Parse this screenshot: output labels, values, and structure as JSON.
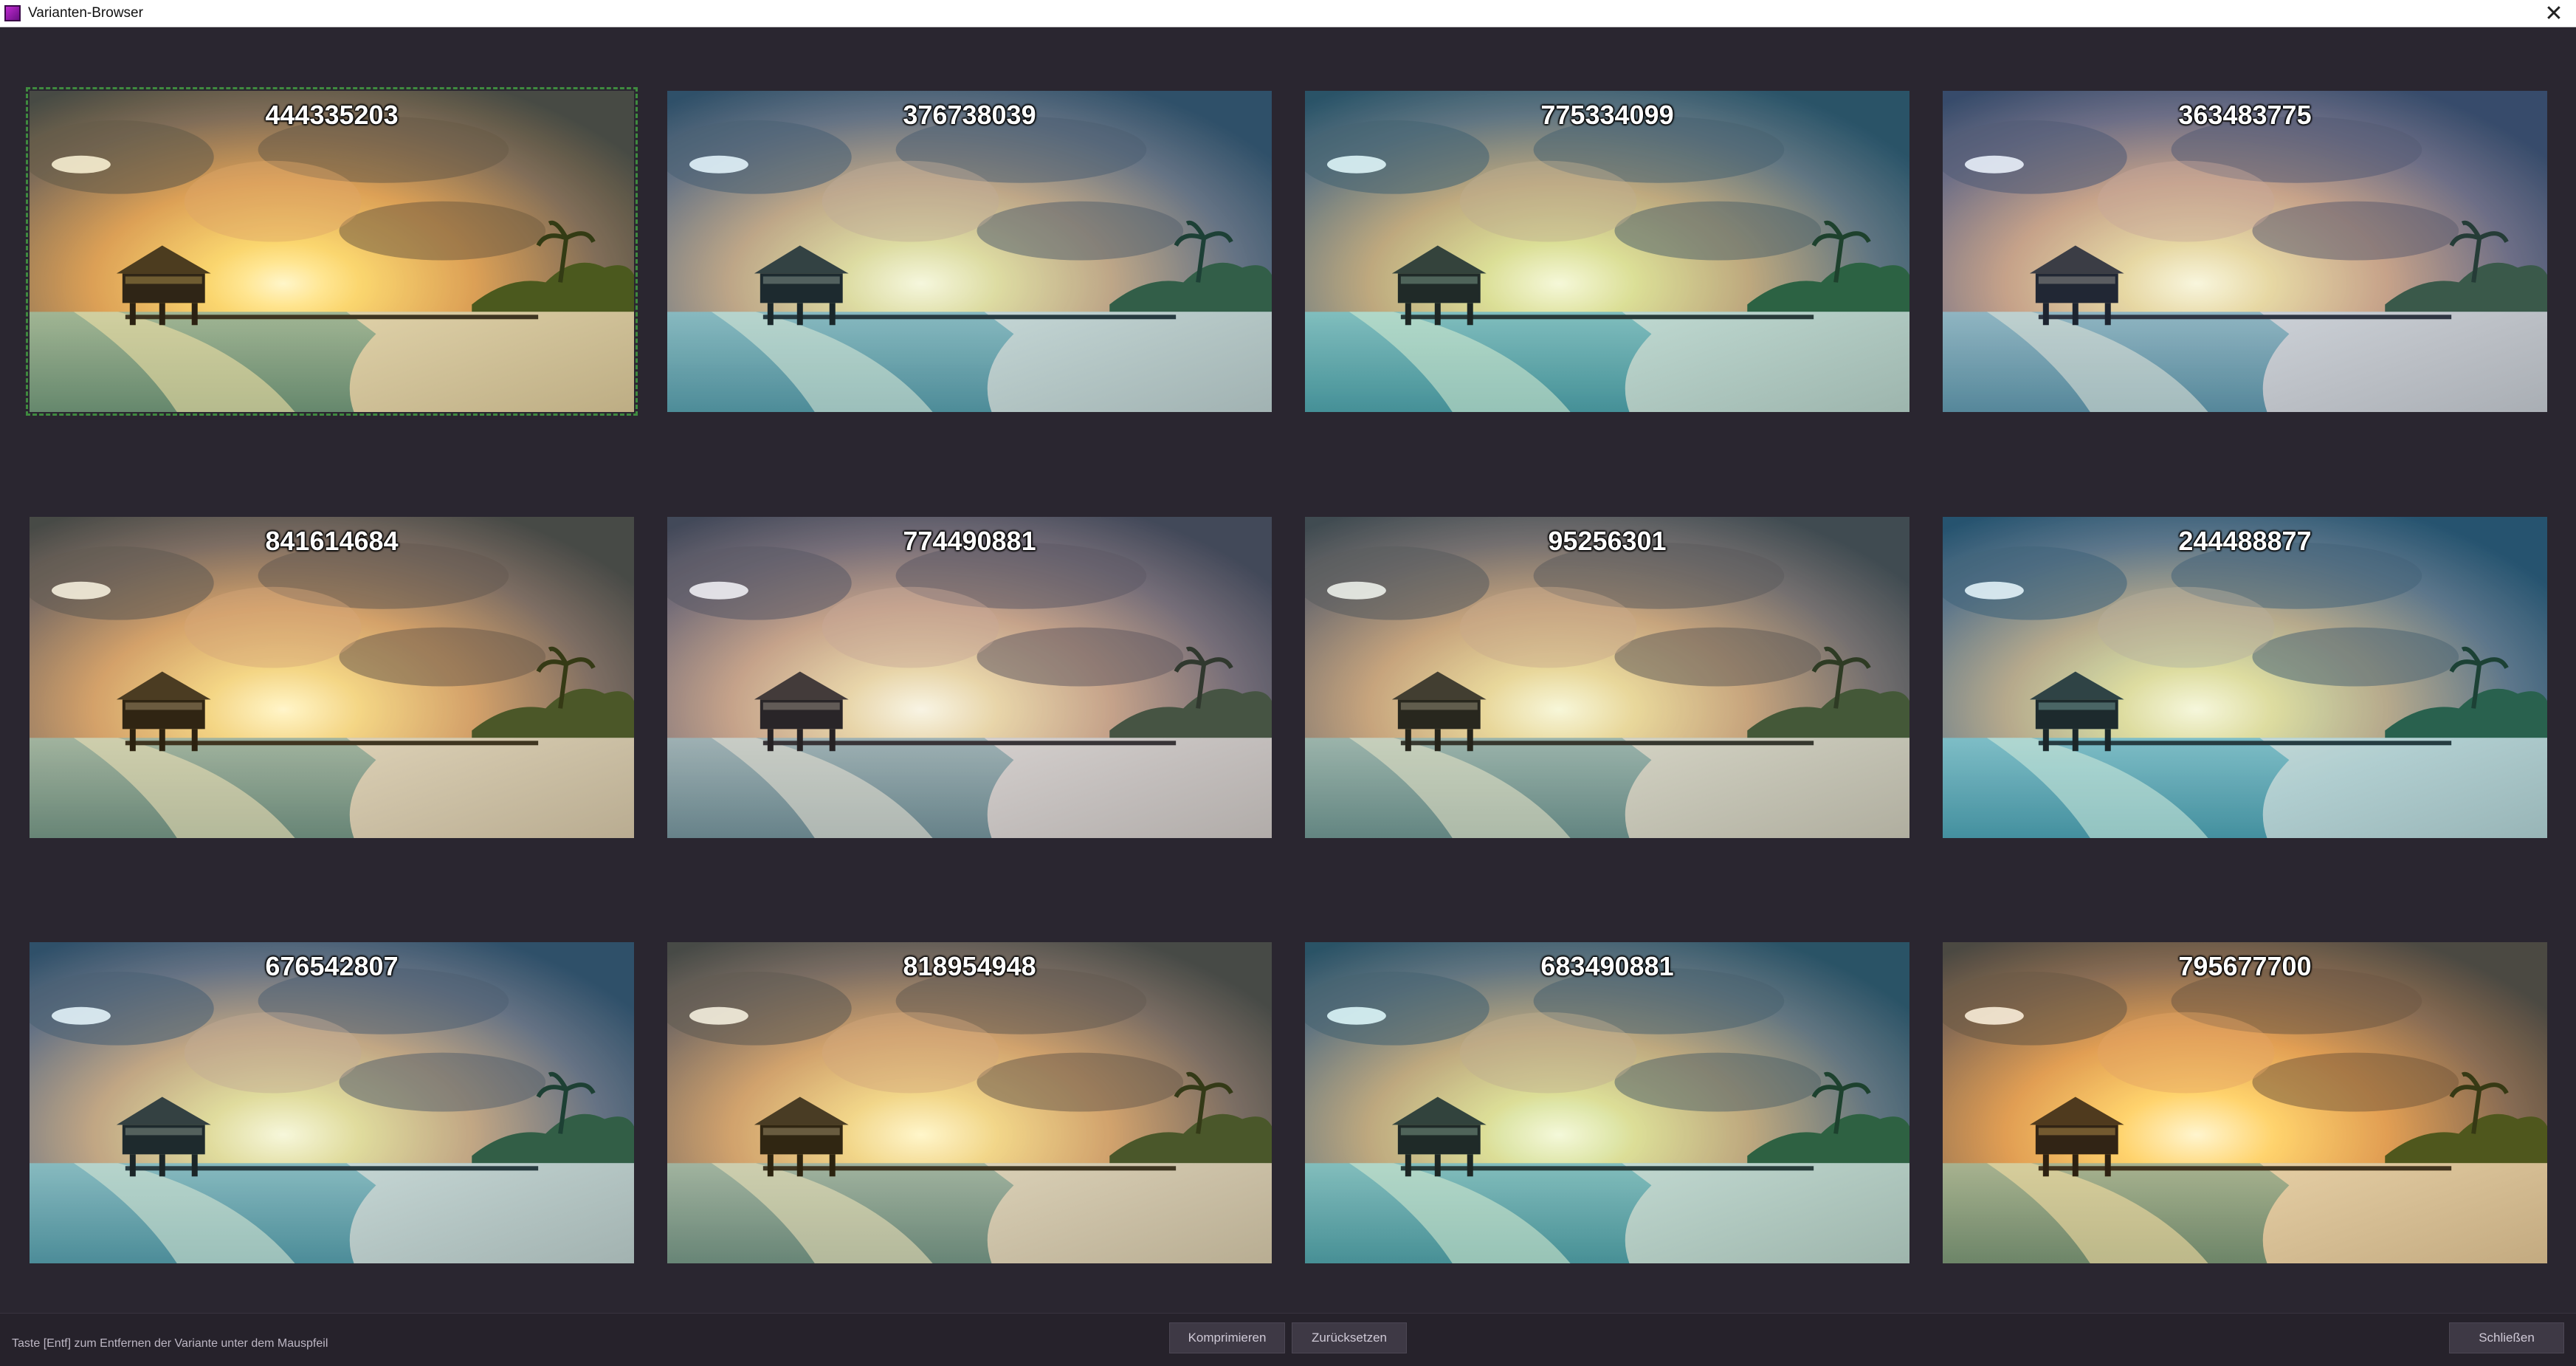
{
  "window": {
    "title": "Varianten-Browser"
  },
  "variants": [
    {
      "id": "444335203",
      "tint": "#d8c060",
      "opacity": 0.32,
      "selected": true
    },
    {
      "id": "376738039",
      "tint": "#2f6f86",
      "opacity": 0.38,
      "selected": false
    },
    {
      "id": "775334099",
      "tint": "#3aa7b0",
      "opacity": 0.3,
      "selected": false
    },
    {
      "id": "363483775",
      "tint": "#2b4a72",
      "opacity": 0.38,
      "selected": false
    },
    {
      "id": "841614684",
      "tint": "#9a8c60",
      "opacity": 0.42,
      "selected": false
    },
    {
      "id": "774490881",
      "tint": "#6a6a72",
      "opacity": 0.55,
      "selected": false
    },
    {
      "id": "95256301",
      "tint": "#a0a89a",
      "opacity": 0.5,
      "selected": false
    },
    {
      "id": "244488877",
      "tint": "#2a90b0",
      "opacity": 0.36,
      "selected": false
    },
    {
      "id": "676542807",
      "tint": "#62a8c0",
      "opacity": 0.34,
      "selected": false
    },
    {
      "id": "818954948",
      "tint": "#b8ae86",
      "opacity": 0.45,
      "selected": false
    },
    {
      "id": "683490881",
      "tint": "#3a9aa0",
      "opacity": 0.32,
      "selected": false
    },
    {
      "id": "795677700",
      "tint": "#d0a040",
      "opacity": 0.34,
      "selected": false
    }
  ],
  "footer": {
    "hint": "Taste [Entf] zum Entfernen der Variante unter dem Mauspfeil",
    "compress_label": "Komprimieren",
    "reset_label": "Zurücksetzen",
    "close_label": "Schließen"
  }
}
